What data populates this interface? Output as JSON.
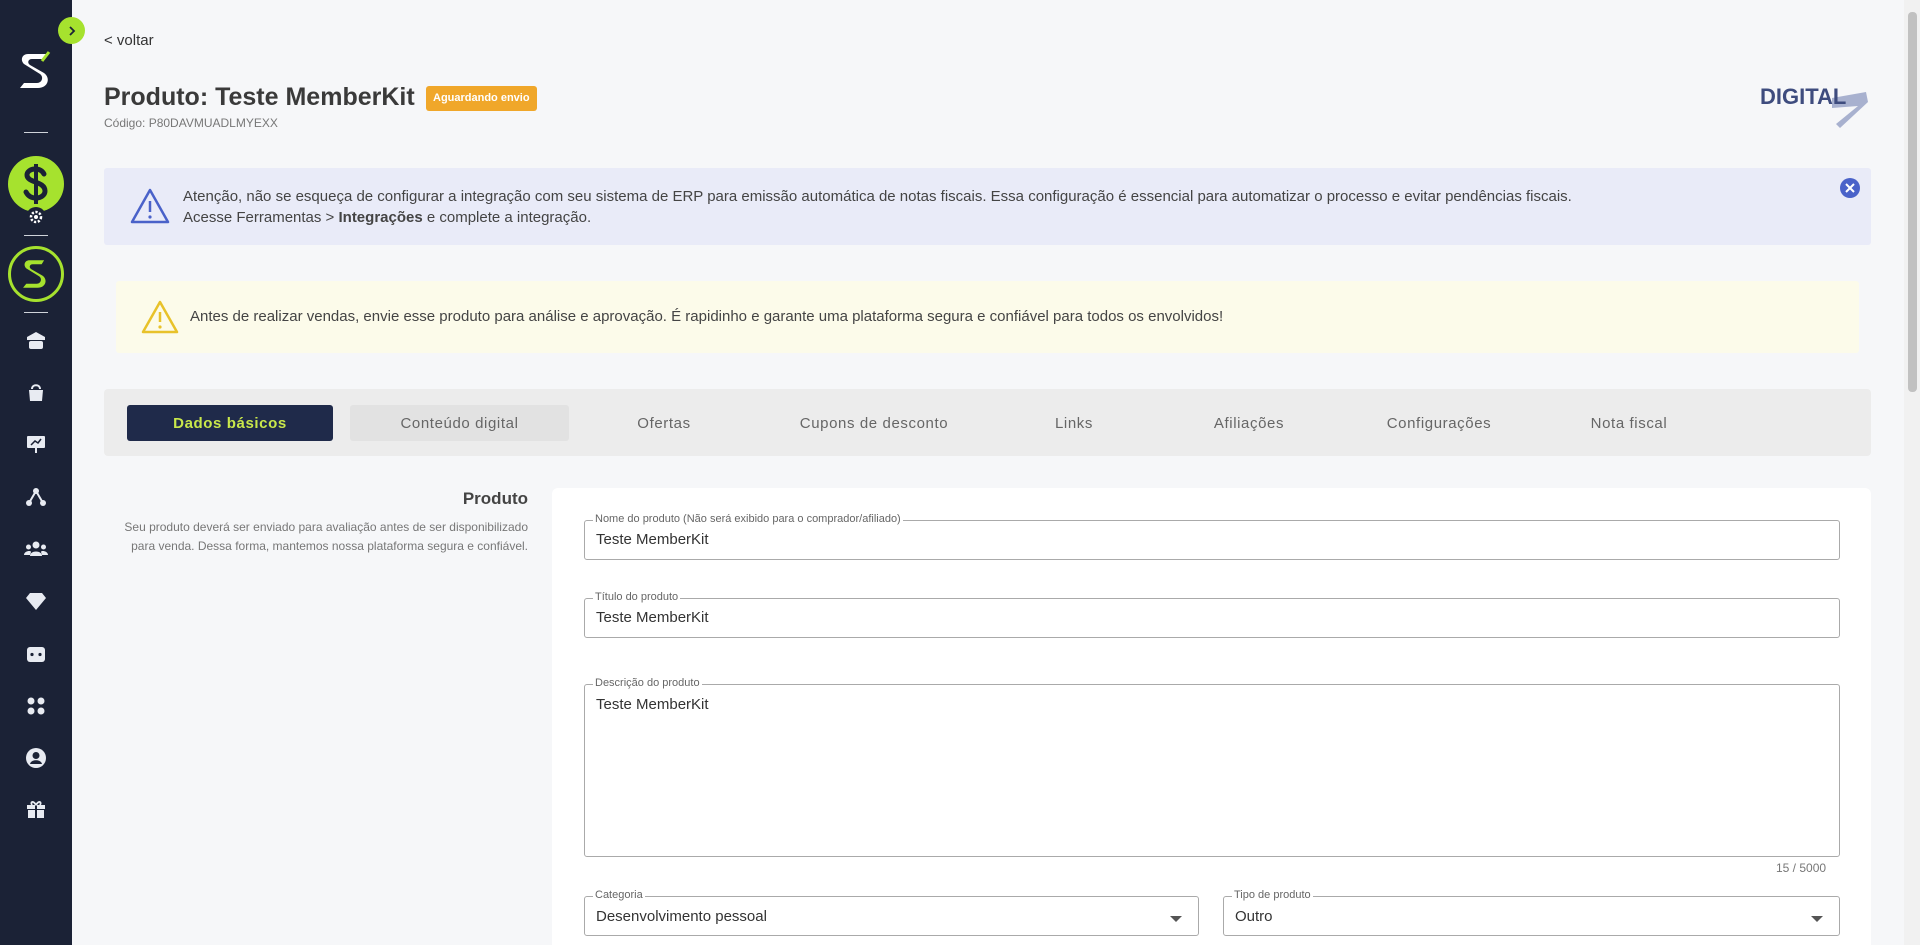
{
  "nav": {
    "back_label": "< voltar"
  },
  "product": {
    "title": "Produto: Teste MemberKit",
    "status": "Aguardando envio",
    "code": "Código: P80DAVMUADLMYEXX",
    "type_logo_text": "DIGITAL"
  },
  "alerts": {
    "erp_line1": "Atenção, não se esqueça de configurar a integração com seu sistema de ERP para emissão automática de notas fiscais. Essa configuração é essencial para automatizar o processo e evitar pendências fiscais.",
    "erp_line2_pre": "Acesse Ferramentas > ",
    "erp_line2_bold": "Integrações",
    "erp_line2_post": " e complete a integração.",
    "review": "Antes de realizar vendas, envie esse produto para análise e aprovação. É rapidinho e garante uma plataforma segura e confiável para todos os envolvidos!"
  },
  "tabs": [
    {
      "label": "Dados básicos",
      "active": true
    },
    {
      "label": "Conteúdo digital"
    },
    {
      "label": "Ofertas"
    },
    {
      "label": "Cupons de desconto"
    },
    {
      "label": "Links"
    },
    {
      "label": "Afiliações"
    },
    {
      "label": "Configurações"
    },
    {
      "label": "Nota fiscal"
    }
  ],
  "section": {
    "title": "Produto",
    "description": "Seu produto deverá ser enviado para avaliação antes de ser disponibilizado para venda. Dessa forma, mantemos nossa plataforma segura e confiável."
  },
  "form": {
    "name": {
      "label": "Nome do produto (Não será exibido para o comprador/afiliado)",
      "value": "Teste MemberKit"
    },
    "title": {
      "label": "Título do produto",
      "value": "Teste MemberKit"
    },
    "description": {
      "label": "Descrição do produto",
      "value": "Teste MemberKit",
      "counter": "15 / 5000"
    },
    "category": {
      "label": "Categoria",
      "value": "Desenvolvimento pessoal"
    },
    "product_type": {
      "label": "Tipo de produto",
      "value": "Outro"
    }
  },
  "colors": {
    "sidebar_bg": "#1b2236",
    "accent_green": "#a6e22e",
    "badge_orange": "#f0a72a",
    "tab_active_bg": "#1f2a4a",
    "tab_active_text": "#c9e84b",
    "info_blue": "#4a62c9"
  },
  "icons": {
    "sidebar": [
      "home-icon",
      "bag-icon",
      "presentation-icon",
      "network-icon",
      "users-icon",
      "diamond-icon",
      "dice-icon",
      "apps-icon",
      "user-circle-icon",
      "gift-icon"
    ]
  }
}
